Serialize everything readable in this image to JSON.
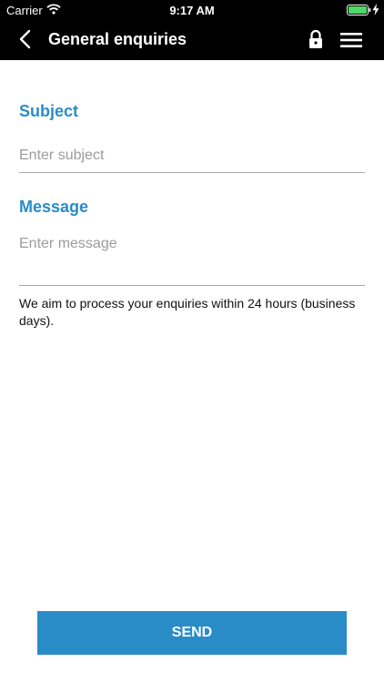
{
  "status_bar": {
    "carrier": "Carrier",
    "time": "9:17 AM",
    "battery_icon": "battery-charging-icon",
    "wifi_icon": "wifi-icon"
  },
  "nav": {
    "title": "General enquiries",
    "back_icon": "chevron-left-icon",
    "lock_icon": "lock-icon",
    "menu_icon": "hamburger-menu-icon"
  },
  "form": {
    "subject_label": "Subject",
    "subject_placeholder": "Enter subject",
    "subject_value": "",
    "message_label": "Message",
    "message_placeholder": "Enter message",
    "message_value": ""
  },
  "note": "We aim to process your enquiries within 24 hours (business days).",
  "send_label": "SEND",
  "colors": {
    "accent": "#2a8cc7",
    "header_bg": "#000000",
    "battery_fill": "#4cd964"
  }
}
